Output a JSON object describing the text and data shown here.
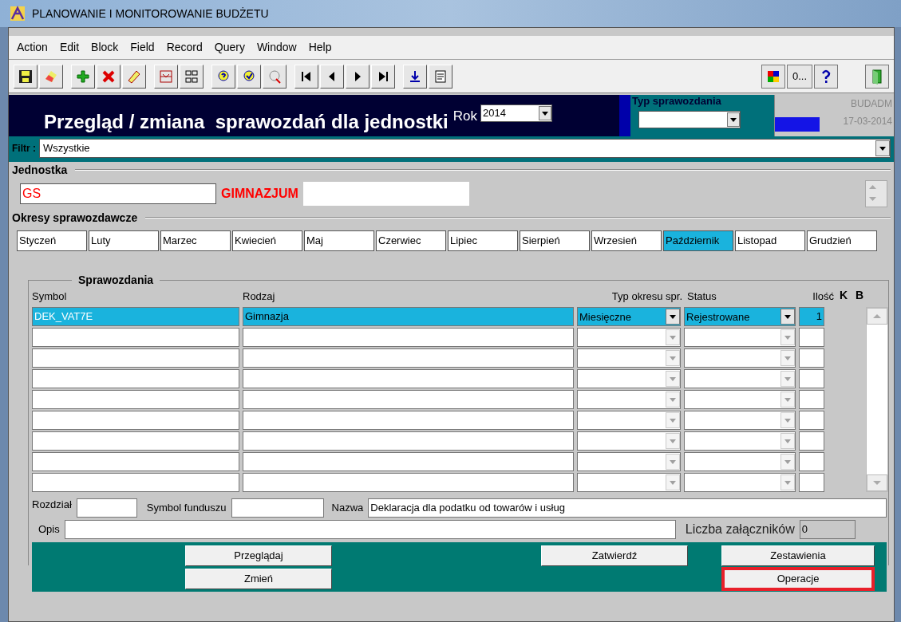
{
  "window": {
    "title": "PLANOWANIE I MONITOROWANIE BUDŻETU"
  },
  "menu": [
    "Action",
    "Edit",
    "Block",
    "Field",
    "Record",
    "Query",
    "Window",
    "Help"
  ],
  "toolbar": {
    "text_button": "0..."
  },
  "header": {
    "title": "Przegląd / zmiana  sprawozdań dla jednostki",
    "year_label": "Rok",
    "year": "2014",
    "report_type_label": "Typ sprawozdania",
    "user": "BUDADM",
    "date": "17-03-2014"
  },
  "filter": {
    "label": "Filtr :",
    "value": "Wszystkie"
  },
  "unit": {
    "section": "Jednostka",
    "code": "GS",
    "name": "GIMNAZJUM"
  },
  "periods": {
    "section": "Okresy sprawozdawcze",
    "items": [
      {
        "label": "Styczeń",
        "selected": false
      },
      {
        "label": "Luty",
        "selected": false
      },
      {
        "label": "Marzec",
        "selected": false
      },
      {
        "label": "Kwiecień",
        "selected": false
      },
      {
        "label": "Maj",
        "selected": false
      },
      {
        "label": "Czerwiec",
        "selected": false
      },
      {
        "label": "Lipiec",
        "selected": false
      },
      {
        "label": "Sierpień",
        "selected": false
      },
      {
        "label": "Wrzesień",
        "selected": false
      },
      {
        "label": "Październik",
        "selected": true
      },
      {
        "label": "Listopad",
        "selected": false
      },
      {
        "label": "Grudzień",
        "selected": false
      }
    ]
  },
  "reports": {
    "section": "Sprawozdania",
    "columns": [
      "Symbol",
      "Rodzaj",
      "Typ okresu spr.",
      "Status",
      "Ilość",
      "K",
      "B"
    ],
    "rows": [
      {
        "symbol": "DEK_VAT7E",
        "type": "Gimnazja",
        "period_type": "Miesięczne",
        "status": "Rejestrowane",
        "count": "1",
        "selected": true
      }
    ]
  },
  "details": {
    "chapter_label": "Rozdział",
    "fund_label": "Symbol funduszu",
    "name_label": "Nazwa",
    "name": "Deklaracja dla podatku od towarów i usług",
    "description_label": "Opis",
    "attachments_label": "Liczba załączników",
    "attachments": "0"
  },
  "buttons": [
    {
      "label": "Przeglądaj",
      "highlighted": false
    },
    {
      "label": "Zmień",
      "highlighted": false
    },
    {
      "label": "Zatwierdź",
      "highlighted": false
    },
    {
      "label": "Zestawienia",
      "highlighted": false
    },
    {
      "label": "Operacje",
      "highlighted": true
    }
  ]
}
